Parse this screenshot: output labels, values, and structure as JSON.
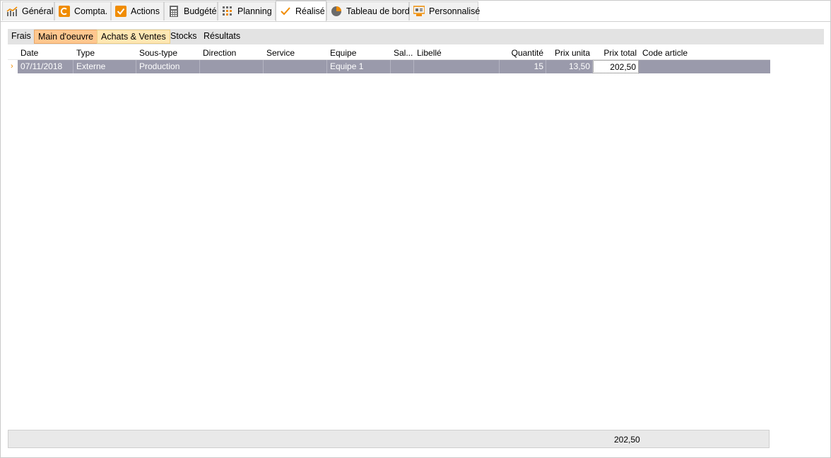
{
  "tabs": [
    {
      "label": "Général",
      "icon": "line-chart-icon"
    },
    {
      "label": "Compta.",
      "icon": "compta-icon"
    },
    {
      "label": "Actions",
      "icon": "checkbox-icon"
    },
    {
      "label": "Budgété",
      "icon": "calculator-icon"
    },
    {
      "label": "Planning",
      "icon": "planning-grid-icon"
    },
    {
      "label": "Réalisé",
      "icon": "checkmark-icon",
      "active": true
    },
    {
      "label": "Tableau de bord",
      "icon": "pie-chart-icon"
    },
    {
      "label": "Personnalisé",
      "icon": "custom-dashboard-icon"
    }
  ],
  "subtabs": [
    {
      "label": "Frais"
    },
    {
      "label": "Main d'oeuvre",
      "state": "selected"
    },
    {
      "label": "Achats & Ventes",
      "state": "hover"
    },
    {
      "label": "Stocks"
    },
    {
      "label": "Résultats"
    }
  ],
  "grid": {
    "columns": [
      "Date",
      "Type",
      "Sous-type",
      "Direction",
      "Service",
      "Equipe",
      "Sal...",
      "Libellé",
      "Quantité",
      "Prix unita",
      "Prix total",
      "Code article"
    ],
    "rows": [
      {
        "date": "07/11/2018",
        "type": "Externe",
        "sous_type": "Production",
        "direction": "",
        "service": "",
        "equipe": "Equipe 1",
        "sal": "",
        "libelle": "",
        "quantite": "15",
        "prix_unitaire": "13,50",
        "prix_total": "202,50",
        "code_article": ""
      }
    ],
    "row_indicator": "›",
    "footer_total": "202,50"
  },
  "colors": {
    "accent": "#f08c00",
    "selected_row": "#9a9aab",
    "subtab_selected": "#ffc78f",
    "subtab_hover": "#ffe7b3"
  }
}
